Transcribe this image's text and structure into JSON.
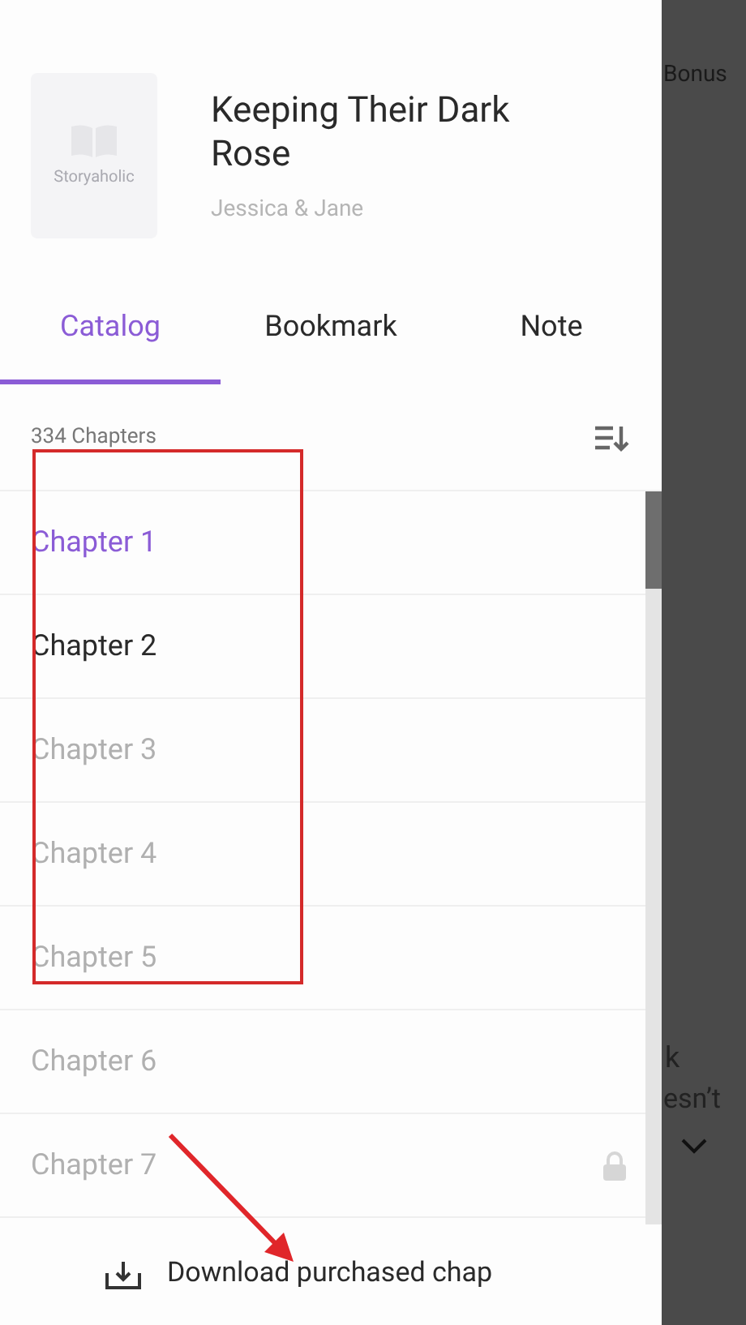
{
  "book": {
    "cover_text": "Storyaholic",
    "title": "Keeping Their Dark Rose",
    "author": "Jessica & Jane"
  },
  "tabs": [
    {
      "label": "Catalog",
      "selected": true
    },
    {
      "label": "Bookmark",
      "selected": false
    },
    {
      "label": "Note",
      "selected": false
    }
  ],
  "chapter_count": "334 Chapters",
  "chapters": [
    {
      "title": "Chapter 1",
      "selected": true,
      "unlocked": true,
      "locked_icon": false
    },
    {
      "title": "Chapter 2",
      "selected": false,
      "unlocked": true,
      "locked_icon": false
    },
    {
      "title": "Chapter 3",
      "selected": false,
      "unlocked": false,
      "locked_icon": false
    },
    {
      "title": "Chapter 4",
      "selected": false,
      "unlocked": false,
      "locked_icon": false
    },
    {
      "title": "Chapter 5",
      "selected": false,
      "unlocked": false,
      "locked_icon": false
    },
    {
      "title": "Chapter 6",
      "selected": false,
      "unlocked": false,
      "locked_icon": false
    },
    {
      "title": "Chapter 7",
      "selected": false,
      "unlocked": false,
      "locked_icon": true
    }
  ],
  "download_button": "Download purchased chap",
  "background_texts": [
    "Bonus",
    "k",
    "esn’t"
  ]
}
